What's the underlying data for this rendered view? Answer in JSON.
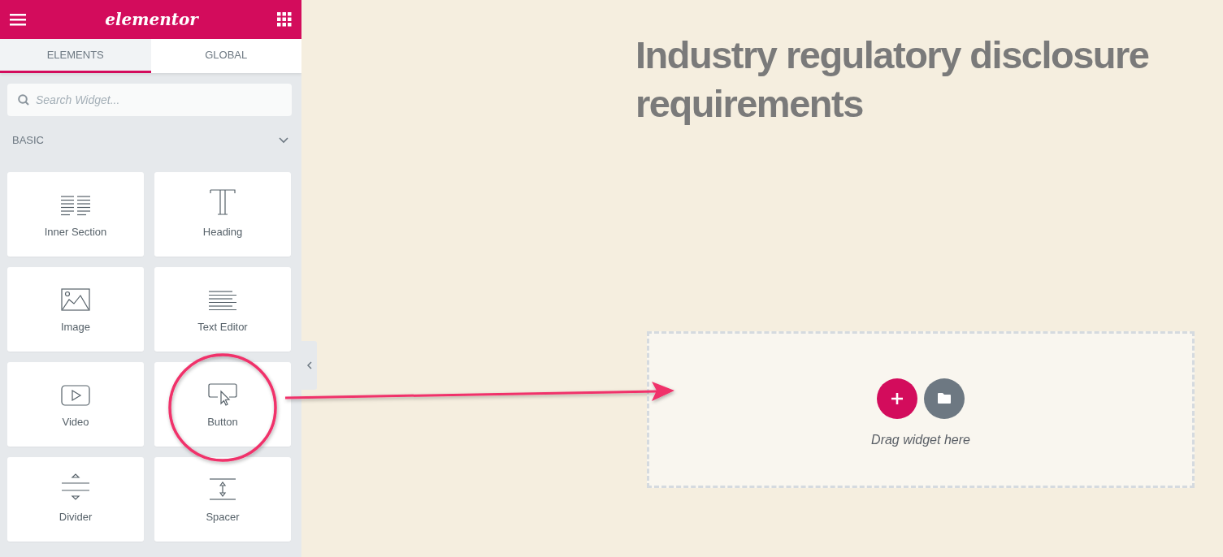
{
  "header": {
    "logo": "elementor"
  },
  "tabs": [
    {
      "label": "ELEMENTS",
      "selected": true
    },
    {
      "label": "GLOBAL",
      "selected": false
    }
  ],
  "search": {
    "placeholder": "Search Widget..."
  },
  "category": {
    "label": "BASIC",
    "expanded": true
  },
  "widgets": [
    {
      "label": "Inner Section"
    },
    {
      "label": "Heading"
    },
    {
      "label": "Image"
    },
    {
      "label": "Text Editor"
    },
    {
      "label": "Video"
    },
    {
      "label": "Button",
      "highlighted": true
    },
    {
      "label": "Divider"
    },
    {
      "label": "Spacer"
    }
  ],
  "canvas": {
    "heading": "Industry regulatory disclosure requirements",
    "drop_zone": {
      "hint": "Drag widget here"
    }
  }
}
